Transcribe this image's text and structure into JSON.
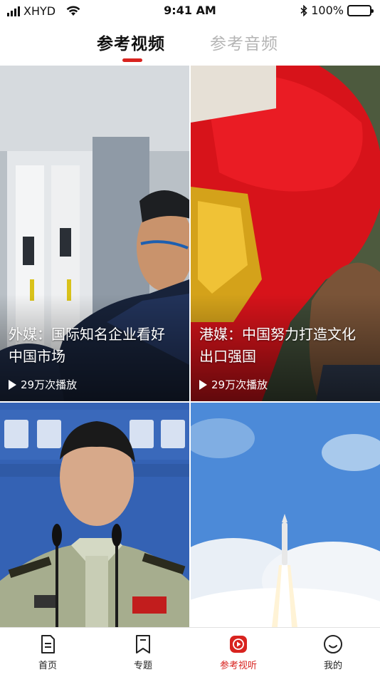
{
  "status_bar": {
    "carrier": "XHYD",
    "time": "9:41 AM",
    "battery": "100%"
  },
  "top_tabs": [
    {
      "label": "参考视频",
      "active": true
    },
    {
      "label": "参考音频",
      "active": false
    }
  ],
  "cards": [
    {
      "title": "外媒：国际知名企业看好中国市场",
      "plays": "29万次播放"
    },
    {
      "title": "港媒：中国努力打造文化出口强国",
      "plays": "29万次播放"
    },
    {
      "title": "",
      "plays": ""
    },
    {
      "title": "",
      "plays": ""
    }
  ],
  "tab_bar": [
    {
      "label": "首页",
      "icon": "document-icon",
      "active": false
    },
    {
      "label": "专题",
      "icon": "bookmark-icon",
      "active": false
    },
    {
      "label": "参考视听",
      "icon": "play-circle-icon",
      "active": true
    },
    {
      "label": "我的",
      "icon": "smile-icon",
      "active": false
    }
  ],
  "colors": {
    "accent": "#d8231f",
    "inactive_tab": "#b5b5b5"
  }
}
